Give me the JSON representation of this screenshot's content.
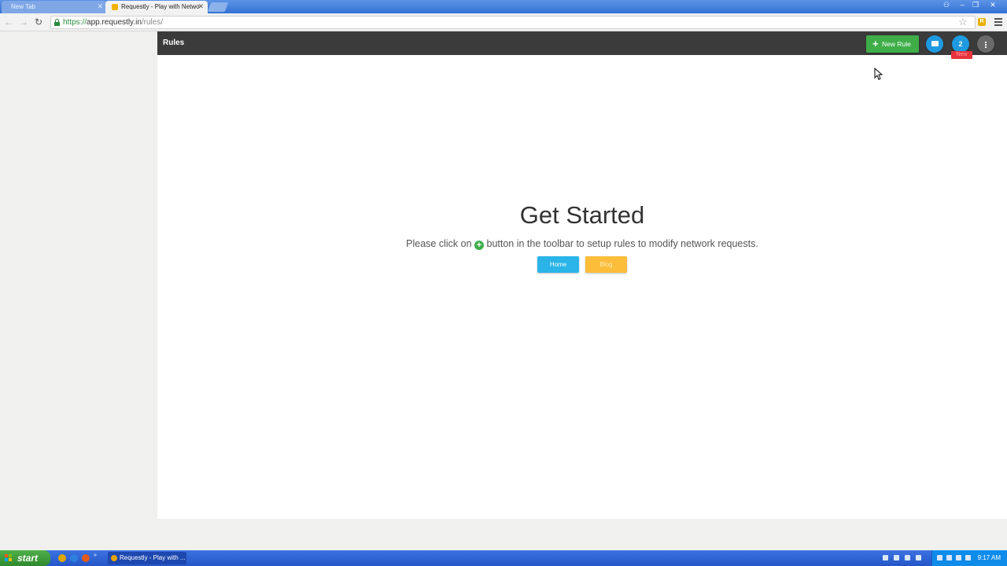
{
  "browser": {
    "tabs": [
      {
        "title": "New Tab",
        "active": false
      },
      {
        "title": "Requestly - Play with Netwo",
        "active": true
      }
    ],
    "url_scheme": "https://",
    "url_host": "app.requestly.in",
    "url_path": "/rules/",
    "icons": {
      "back": "back-arrow-icon",
      "forward": "forward-arrow-icon",
      "reload": "reload-icon",
      "bookmark": "star-icon",
      "extension": "requestly-extension-icon",
      "menu": "hamburger-menu-icon"
    }
  },
  "app": {
    "page_title": "Rules",
    "new_rule_label": "New Rule",
    "notification_count": "2",
    "new_badge": "New",
    "colors": {
      "appbar": "#3b3b3b",
      "new_rule_button": "#3fae49",
      "circle_button": "#1e9ae0",
      "home_button": "#2ab4e8",
      "blog_button": "#fbbd3a",
      "badge": "#e8343e"
    }
  },
  "empty_state": {
    "headline": "Get Started",
    "text_before": "Please click on ",
    "text_after": " button in the toolbar to setup rules to modify network requests.",
    "home_label": "Home",
    "blog_label": "Blog"
  },
  "taskbar": {
    "start_label": "start",
    "task_label": "Requestly - Play with ...",
    "clock": "9:17 AM"
  }
}
